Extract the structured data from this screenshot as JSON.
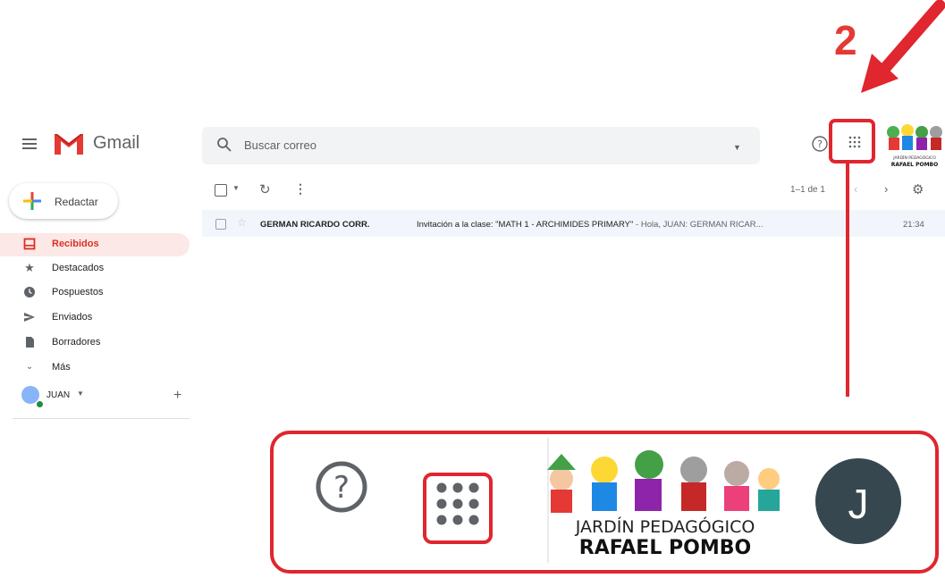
{
  "annotation": {
    "step": "2"
  },
  "header": {
    "app_name": "Gmail",
    "search_placeholder": "Buscar correo"
  },
  "compose": {
    "label": "Redactar"
  },
  "sidebar": {
    "items": [
      {
        "label": "Recibidos",
        "icon": "inbox-icon",
        "active": true
      },
      {
        "label": "Destacados",
        "icon": "star-icon"
      },
      {
        "label": "Pospuestos",
        "icon": "clock-icon"
      },
      {
        "label": "Enviados",
        "icon": "send-icon"
      },
      {
        "label": "Borradores",
        "icon": "draft-icon"
      },
      {
        "label": "Más",
        "icon": "chevron-down-icon"
      }
    ],
    "user": {
      "name": "JUAN"
    }
  },
  "toolbar": {
    "pager": "1–1 de 1"
  },
  "emails": [
    {
      "sender": "GERMAN RICARDO CORR.",
      "subject": "Invitación a la clase: \"MATH 1 - ARCHIMIDES PRIMARY\"",
      "snippet": " - Hola, JUAN: GERMAN RICAR...",
      "time": "21:34"
    }
  ],
  "zoom": {
    "logo_line1": "JARDÍN PEDAGÓGICO",
    "logo_line2": "RAFAEL POMBO",
    "avatar_letter": "J"
  },
  "logo_small": {
    "line1": "JARDÍN PEDAGÓGICO",
    "line2": "RAFAEL POMBO"
  },
  "colors": {
    "annotation_red": "#e0262e",
    "gmail_red": "#d93025",
    "avatar_dark": "#37474f"
  }
}
